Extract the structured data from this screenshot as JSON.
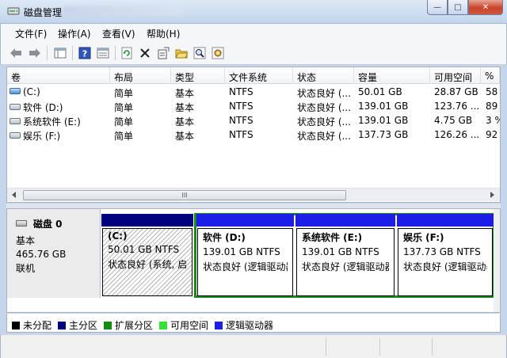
{
  "window": {
    "title": "磁盘管理",
    "min_glyph": "—",
    "max_glyph": "□",
    "close_glyph": "✕"
  },
  "menu": [
    "文件(F)",
    "操作(A)",
    "查看(V)",
    "帮助(H)"
  ],
  "toolbar": [
    {
      "name": "back-icon",
      "glyph": "⇦"
    },
    {
      "name": "forward-icon",
      "glyph": "⇨"
    },
    {
      "name": "console-tree-icon",
      "glyph": "▤"
    },
    {
      "name": "help-icon",
      "glyph": "?"
    },
    {
      "name": "properties-list-icon",
      "glyph": "▦"
    },
    {
      "name": "refresh-icon",
      "glyph": "↻"
    },
    {
      "name": "delete-icon",
      "glyph": "✕"
    },
    {
      "name": "properties-icon",
      "glyph": "✎"
    },
    {
      "name": "open-folder-icon",
      "glyph": "⌸"
    },
    {
      "name": "find-icon",
      "glyph": "⌕"
    },
    {
      "name": "settings-icon",
      "glyph": "⚙"
    }
  ],
  "volumes": {
    "columns": [
      "卷",
      "布局",
      "类型",
      "文件系统",
      "状态",
      "容量",
      "可用空间",
      "%"
    ],
    "rows": [
      {
        "volume": "(C:)",
        "layout": "简单",
        "type": "基本",
        "fs": "NTFS",
        "status": "状态良好 (...",
        "capacity": "50.01 GB",
        "free": "28.87 GB",
        "pct": "58",
        "icon": "system"
      },
      {
        "volume": "软件 (D:)",
        "layout": "简单",
        "type": "基本",
        "fs": "NTFS",
        "status": "状态良好 (...",
        "capacity": "139.01 GB",
        "free": "123.76 ...",
        "pct": "89",
        "icon": "drive"
      },
      {
        "volume": "系统软件 (E:)",
        "layout": "简单",
        "type": "基本",
        "fs": "NTFS",
        "status": "状态良好 (...",
        "capacity": "139.01 GB",
        "free": "4.75 GB",
        "pct": "3 %",
        "icon": "drive"
      },
      {
        "volume": "娱乐 (F:)",
        "layout": "简单",
        "type": "基本",
        "fs": "NTFS",
        "status": "状态良好 (...",
        "capacity": "137.73 GB",
        "free": "126.26 ...",
        "pct": "92",
        "icon": "drive"
      }
    ],
    "scroll_thumb_glyph": "III"
  },
  "disk": {
    "name": "磁盘 0",
    "type": "基本",
    "size": "465.76 GB",
    "state": "联机"
  },
  "partitions": [
    {
      "name": "(C:)",
      "size": "50.01 GB NTFS",
      "status": "状态良好 (系统, 启",
      "kind": "primary"
    },
    {
      "name": "软件   (D:)",
      "size": "139.01 GB NTFS",
      "status": "状态良好 (逻辑驱动器",
      "kind": "logical"
    },
    {
      "name": "系统软件   (E:)",
      "size": "139.01 GB NTFS",
      "status": "状态良好 (逻辑驱动器",
      "kind": "logical"
    },
    {
      "name": "娱乐   (F:)",
      "size": "137.73 GB NTFS",
      "status": "状态良好 (逻辑驱动器",
      "kind": "logical"
    }
  ],
  "legend": [
    {
      "label": "未分配",
      "color": "#000000"
    },
    {
      "label": "主分区",
      "color": "#00007f"
    },
    {
      "label": "扩展分区",
      "color": "#138c13"
    },
    {
      "label": "可用空间",
      "color": "#33e233"
    },
    {
      "label": "逻辑驱动器",
      "color": "#1d1de8"
    }
  ],
  "colors": {
    "primary": "#00007f",
    "logical": "#1d1de8",
    "extended": "#138c13"
  }
}
